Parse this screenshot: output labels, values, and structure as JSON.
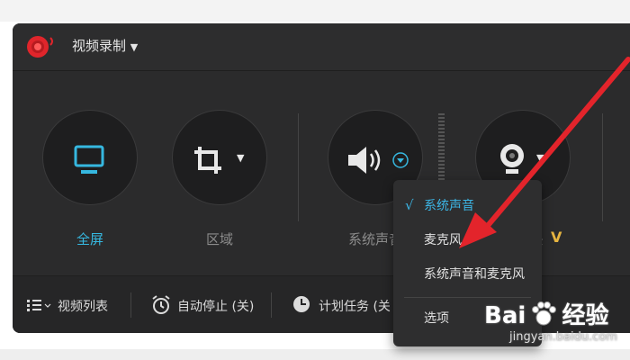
{
  "window": {
    "title": "视频录制",
    "accent": "#36b8e0",
    "logo_color": "#e0252b"
  },
  "sources": [
    {
      "label": "全屏",
      "icon": "monitor-icon",
      "active": true
    },
    {
      "label": "区域",
      "icon": "crop-icon",
      "active": false
    },
    {
      "label": "系统声音",
      "icon": "speaker-icon",
      "active": false
    },
    {
      "label": "摄像头",
      "icon": "webcam-icon",
      "active": false,
      "badge": "V"
    }
  ],
  "bottombar": {
    "video_list": "视频列表",
    "auto_stop": "自动停止 (关)",
    "scheduled_task": "计划任务 (关"
  },
  "audio_menu": {
    "items": [
      {
        "label": "系统声音",
        "checked": true
      },
      {
        "label": "麦克风",
        "checked": false
      },
      {
        "label": "系统声音和麦克风",
        "checked": false
      },
      {
        "label": "选项",
        "checked": false
      }
    ],
    "checkmark": "√"
  },
  "annotation": {
    "arrow_color": "#e3242b"
  },
  "watermark": {
    "brand": "Bai",
    "brand2": "经验",
    "url": "jingyan.baidu.com"
  }
}
